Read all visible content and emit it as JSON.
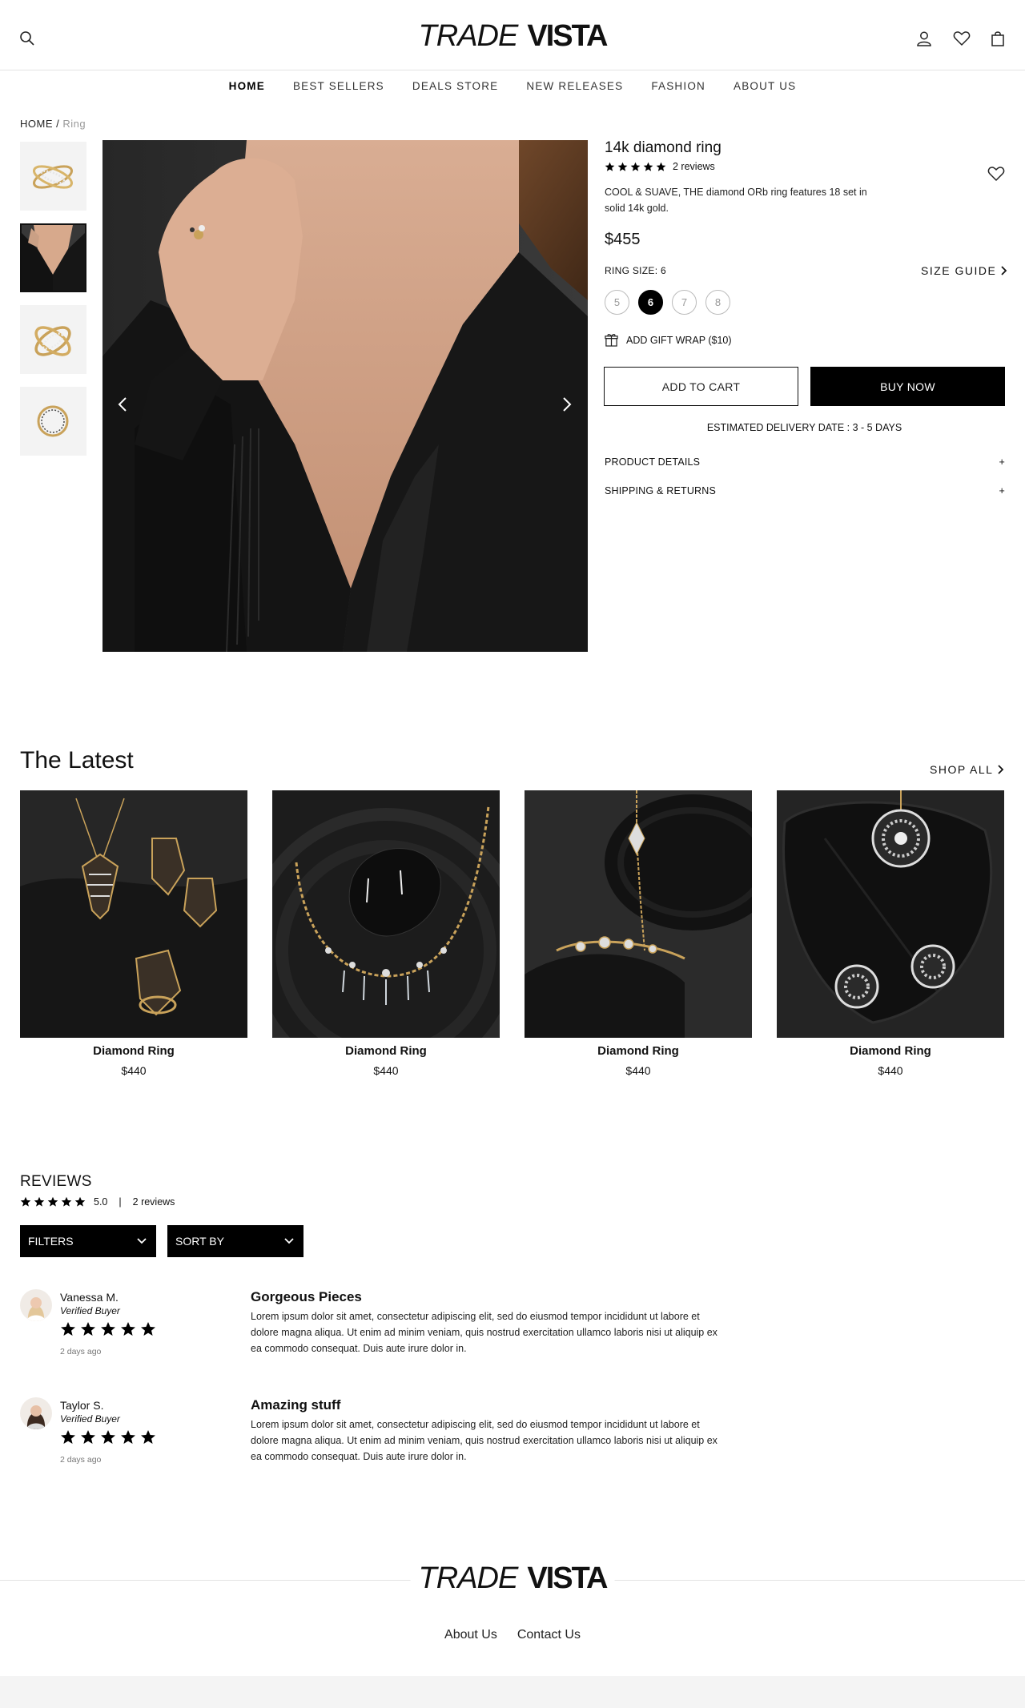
{
  "header": {
    "logo_part1": "TRADE",
    "logo_part2": "VISTA",
    "icons": [
      "search-icon",
      "user-icon",
      "heart-icon",
      "bag-icon"
    ]
  },
  "nav": {
    "items": [
      "HOME",
      "BEST SELLERS",
      "DEALS STORE",
      "NEW RELEASES",
      "FASHION",
      "ABOUT US"
    ],
    "active": "HOME"
  },
  "breadcrumb": {
    "home": "HOME",
    "separator": "/",
    "current": "Ring"
  },
  "product": {
    "title": "14k diamond ring",
    "rating": 5,
    "reviews_label": "2 reviews",
    "description": "COOL & SUAVE, THE diamond ORb ring features 18 set in solid 14k gold.",
    "price": "$455",
    "size_label": "RING SIZE: 6",
    "size_guide": "SIZE GUIDE",
    "sizes": [
      "5",
      "6",
      "7",
      "8"
    ],
    "selected_size": "6",
    "gift_wrap": "ADD GIFT WRAP ($10)",
    "add_to_cart": "ADD TO CART",
    "buy_now": "BUY NOW",
    "delivery": "ESTIMATED DELIVERY DATE : 3 - 5 DAYS",
    "accordions": [
      {
        "label": "PRODUCT DETAILS",
        "toggle": "+"
      },
      {
        "label": "SHIPPING & RETURNS",
        "toggle": "+"
      }
    ]
  },
  "latest": {
    "title": "The Latest",
    "shop_all": "SHOP ALL",
    "items": [
      {
        "name": "Diamond Ring",
        "price": "$440"
      },
      {
        "name": "Diamond Ring",
        "price": "$440"
      },
      {
        "name": "Diamond Ring",
        "price": "$440"
      },
      {
        "name": "Diamond Ring",
        "price": "$440"
      }
    ]
  },
  "reviews": {
    "title": "REVIEWS",
    "score": "5.0",
    "divider": "|",
    "count_label": "2 reviews",
    "filters_label": "FILTERS",
    "sort_label": "SORT BY",
    "items": [
      {
        "name": "Vanessa M.",
        "badge": "Verified Buyer",
        "date": "2 days ago",
        "title": "Gorgeous Pieces",
        "body": "Lorem ipsum dolor sit amet, consectetur adipiscing elit, sed do eiusmod tempor incididunt ut labore et dolore magna aliqua. Ut enim ad minim veniam, quis nostrud exercitation ullamco laboris nisi ut aliquip ex ea commodo consequat. Duis aute irure dolor in."
      },
      {
        "name": "Taylor S.",
        "badge": "Verified Buyer",
        "date": "2 days ago",
        "title": "Amazing stuff",
        "body": "Lorem ipsum dolor sit amet, consectetur adipiscing elit, sed do eiusmod tempor incididunt ut labore et dolore magna aliqua. Ut enim ad minim veniam, quis nostrud exercitation ullamco laboris nisi ut aliquip ex ea commodo consequat. Duis aute irure dolor in."
      }
    ]
  },
  "footer": {
    "logo_part1": "TRADE",
    "logo_part2": "VISTA",
    "links": [
      "About Us",
      "Contact Us"
    ]
  }
}
